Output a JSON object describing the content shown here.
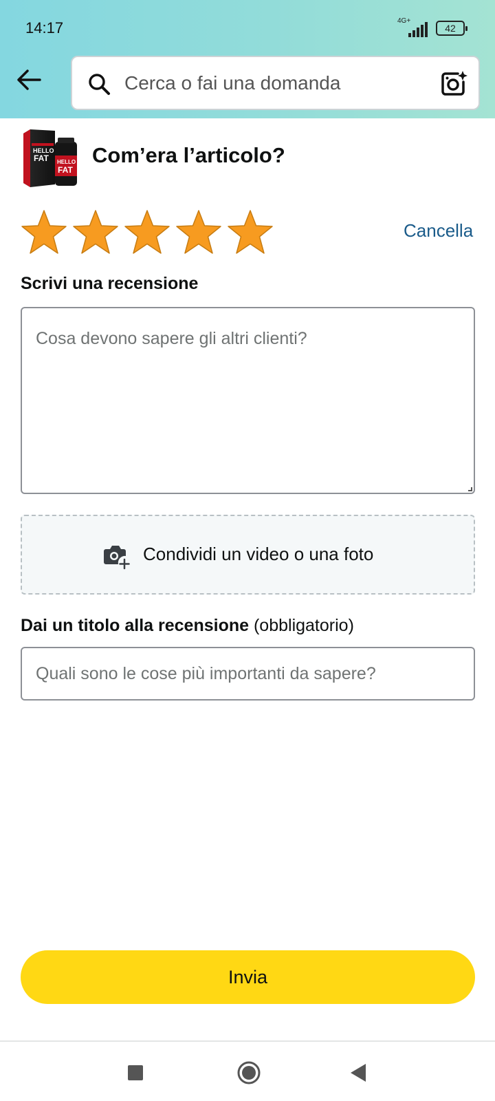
{
  "status_bar": {
    "time": "14:17",
    "network": "4G+",
    "battery": "42"
  },
  "search": {
    "placeholder": "Cerca o fai una domanda"
  },
  "product": {
    "image_line1": "HELLO",
    "image_line2": "FAT"
  },
  "rating": {
    "question": "Com’era l’articolo?",
    "stars_selected": 5,
    "stars_total": 5,
    "cancel_label": "Cancella",
    "star_color": "#f79b20"
  },
  "review": {
    "label": "Scrivi una recensione",
    "placeholder": "Cosa devono sapere gli altri clienti?"
  },
  "upload": {
    "label": "Condividi un video o una foto"
  },
  "title_field": {
    "label": "Dai un titolo alla recensione",
    "optional_note": "(obbligatorio)",
    "placeholder": "Quali sono le cose più importanti da sapere?"
  },
  "submit": {
    "label": "Invia",
    "color": "#ffd814"
  },
  "icons": [
    "back-arrow-icon",
    "search-icon",
    "camera-search-icon",
    "star-icon",
    "add-photo-icon",
    "nav-recents-icon",
    "nav-home-icon",
    "nav-back-icon"
  ]
}
